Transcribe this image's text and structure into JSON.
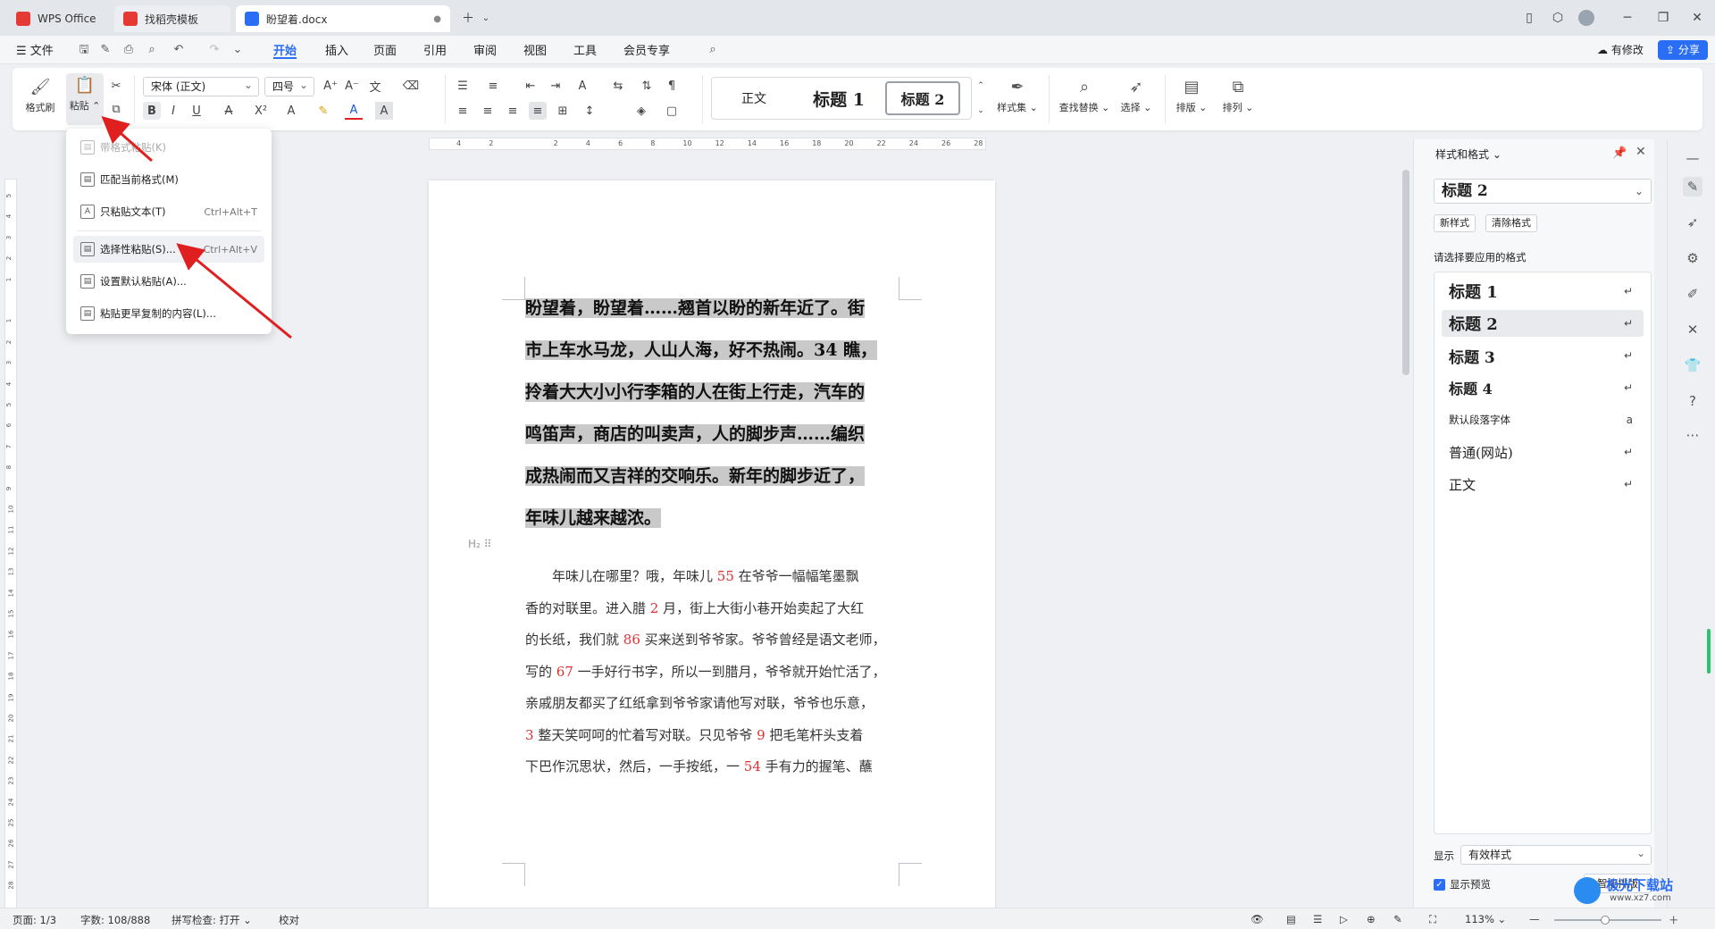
{
  "tabs": [
    {
      "label": "WPS Office",
      "icon": "wps-logo-icon",
      "color": "#e53935"
    },
    {
      "label": "找稻壳模板",
      "icon": "docer-icon",
      "color": "#e53935"
    },
    {
      "label": "盼望着.docx",
      "icon": "word-doc-icon",
      "color": "#2a6ef5"
    }
  ],
  "menu": {
    "file": "文件",
    "items": [
      "开始",
      "插入",
      "页面",
      "引用",
      "审阅",
      "视图",
      "工具",
      "会员专享"
    ],
    "active": "开始",
    "has_changes": "有修改",
    "share": "分享"
  },
  "ribbon": {
    "format_painter": "格式刷",
    "paste": "粘贴",
    "font_name": "宋体 (正文)",
    "font_size": "四号",
    "styles": [
      "正文",
      "标题 1",
      "标题 2"
    ],
    "style_set": "样式集",
    "find_replace": "查找替换",
    "select": "选择",
    "layout": "排版",
    "arrange": "排列"
  },
  "paste_menu": [
    {
      "label": "带格式粘贴(K)",
      "shortcut": "",
      "disabled": true
    },
    {
      "label": "匹配当前格式(M)",
      "shortcut": ""
    },
    {
      "label": "只粘贴文本(T)",
      "shortcut": "Ctrl+Alt+T"
    },
    {
      "label": "选择性粘贴(S)...",
      "shortcut": "Ctrl+Alt+V",
      "hover": true
    },
    {
      "label": "设置默认粘贴(A)...",
      "shortcut": ""
    },
    {
      "label": "粘贴更早复制的内容(L)...",
      "shortcut": ""
    }
  ],
  "ruler": {
    "h_ticks": [
      "4",
      "2",
      "",
      "2",
      "4",
      "6",
      "8",
      "10",
      "12",
      "14",
      "16",
      "18",
      "20",
      "22",
      "24",
      "26",
      "28"
    ],
    "v_ticks": [
      "5",
      "4",
      "3",
      "2",
      "1",
      "",
      "1",
      "2",
      "3",
      "4",
      "5",
      "6",
      "7",
      "8",
      "9",
      "10",
      "11",
      "12",
      "13",
      "14",
      "15",
      "16",
      "17",
      "18",
      "19",
      "20",
      "21",
      "22",
      "23",
      "24",
      "25",
      "26",
      "27",
      "28"
    ]
  },
  "document": {
    "heading_marker": "H₂",
    "heading_lines": [
      "盼望着，盼望着……翘首以盼的新年近了。街",
      "市上车水马龙，人山人海，好不热闹。34 瞧，",
      "拎着大大小小行李箱的人在街上行走，汽车的",
      "鸣笛声，商店的叫卖声，人的脚步声……编织",
      "成热闹而又吉祥的交响乐。新年的脚步近了，",
      "年味儿越来越浓。"
    ],
    "body_lines": [
      [
        {
          "t": "　　年味儿在哪里？哦，年味儿 "
        },
        {
          "t": "55",
          "red": true
        },
        {
          "t": " 在爷爷一幅幅笔墨飘"
        }
      ],
      [
        {
          "t": "香的对联里。进入腊 "
        },
        {
          "t": "2",
          "red": true
        },
        {
          "t": " 月，街上大街小巷开始卖起了大红"
        }
      ],
      [
        {
          "t": "的长纸，我们就 "
        },
        {
          "t": "86",
          "red": true
        },
        {
          "t": " 买来送到爷爷家。爷爷曾经是语文老师，"
        }
      ],
      [
        {
          "t": "写的 "
        },
        {
          "t": "67",
          "red": true
        },
        {
          "t": " 一手好行书字，所以一到腊月，爷爷就开始忙活了，"
        }
      ],
      [
        {
          "t": "亲戚朋友都买了红纸拿到爷爷家请他写对联，爷爷也乐意，"
        }
      ],
      [
        {
          "t": "3",
          "red": true
        },
        {
          "t": " 整天笑呵呵的忙着写对联。只见爷爷 "
        },
        {
          "t": "9",
          "red": true
        },
        {
          "t": " 把毛笔杆头支着"
        }
      ],
      [
        {
          "t": "下巴作沉思状，然后，一手按纸，一 "
        },
        {
          "t": "54",
          "red": true
        },
        {
          "t": " 手有力的握笔、蘸"
        }
      ]
    ]
  },
  "panel": {
    "title": "样式和格式",
    "current_style": "标题 2",
    "new_style": "新样式",
    "clear_format": "清除格式",
    "prompt": "请选择要应用的格式",
    "styles": [
      {
        "label": "标题 1",
        "kind": "h1",
        "mark": "↵"
      },
      {
        "label": "标题 2",
        "kind": "h2",
        "mark": "↵",
        "selected": true
      },
      {
        "label": "标题 3",
        "kind": "h3",
        "mark": "↵"
      },
      {
        "label": "标题 4",
        "kind": "h4",
        "mark": "↵"
      },
      {
        "label": "默认段落字体",
        "kind": "small",
        "mark": "a"
      },
      {
        "label": "普通(网站)",
        "kind": "normal",
        "mark": "↵"
      },
      {
        "label": "正文",
        "kind": "normal",
        "mark": "↵"
      }
    ],
    "show_label": "显示",
    "show_value": "有效样式",
    "preview_label": "显示预览",
    "smart_layout": "智能排版"
  },
  "status": {
    "page": "页面: 1/3",
    "words": "字数: 108/888",
    "spell": "拼写检查: 打开",
    "proof": "校对",
    "zoom": "113%"
  },
  "watermark": "极光下载站",
  "watermark_url": "www.xz7.com",
  "colors": {
    "accent": "#2a6ef5",
    "arrow": "#e02020",
    "highlight": "#c9c9c9"
  }
}
